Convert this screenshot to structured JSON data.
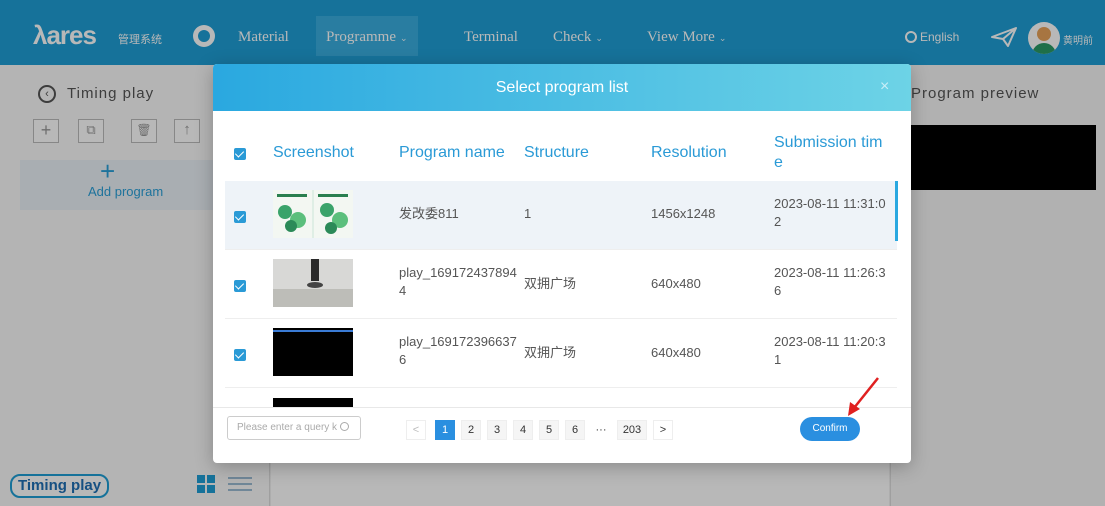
{
  "app": {
    "logo_text": "ares",
    "logo_prefix": "λ",
    "logo_sub": "管理系统",
    "nav": [
      {
        "label": "Material"
      },
      {
        "label": "Programme"
      },
      {
        "label": "Terminal"
      },
      {
        "label": "Check"
      },
      {
        "label": "View More"
      }
    ],
    "language": "English",
    "username": "黄明前"
  },
  "left_panel": {
    "back_icon": "chevron-left-icon",
    "title": "Timing play",
    "tools": [
      "+",
      "⧉",
      "🗑",
      "↑"
    ],
    "add_plus": "+",
    "add_label": "Add program",
    "footer_tag": "Timing play"
  },
  "right_panel": {
    "title": "Program preview"
  },
  "dialog": {
    "title": "Select program list",
    "close": "×",
    "columns": [
      "Screenshot",
      "Program name",
      "Structure",
      "Resolution",
      "Submission time"
    ],
    "column_display": [
      "Screenshot",
      "Program name",
      "Structure",
      "Resolution",
      "Submission tim",
      "e"
    ],
    "rows": [
      {
        "name": "发改委811",
        "structure": "1",
        "resolution": "1456x1248",
        "time": "2023-08-11 11:31:02",
        "time_l1": "2023-08-11 11:31:0",
        "time_l2": "2",
        "checked": true,
        "selected": true
      },
      {
        "name": "play_1691724378944",
        "name_l1": "play_169172437894",
        "name_l2": "4",
        "structure": "双拥广场",
        "resolution": "640x480",
        "time": "2023-08-11 11:26:36",
        "time_l1": "2023-08-11 11:26:3",
        "time_l2": "6",
        "checked": true,
        "selected": false
      },
      {
        "name": "play_1691723966376",
        "name_l1": "play_169172396637",
        "name_l2": "6",
        "structure": "双拥广场",
        "resolution": "640x480",
        "time": "2023-08-11 11:20:31",
        "time_l1": "2023-08-11 11:20:3",
        "time_l2": "1",
        "checked": true,
        "selected": false
      }
    ],
    "search_placeholder": "Please enter a query k",
    "pagination": {
      "prev": "<",
      "pages": [
        "1",
        "2",
        "3",
        "4",
        "5",
        "6"
      ],
      "ellipsis": "···",
      "last": "203",
      "next": ">",
      "current": "1"
    },
    "confirm_label": "Confirm"
  },
  "colors": {
    "brand": "#1f9fd6",
    "accent": "#2a8fe0",
    "header_gradient_end": "#6dd3e6",
    "annotation_arrow": "#e02020"
  }
}
